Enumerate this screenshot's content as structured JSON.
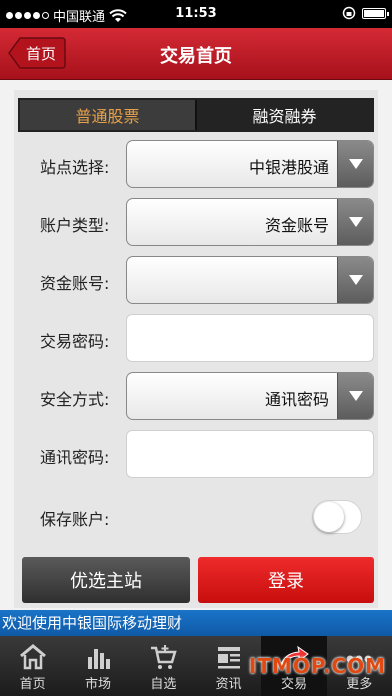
{
  "status": {
    "carrier": "中国联通",
    "time": "11:53"
  },
  "header": {
    "back_label": "首页",
    "title": "交易首页"
  },
  "tabs": [
    {
      "label": "普通股票",
      "active": true
    },
    {
      "label": "融资融券",
      "active": false
    }
  ],
  "form": {
    "site_label": "站点选择:",
    "site_value": "中银港股通",
    "account_type_label": "账户类型:",
    "account_type_value": "资金账号",
    "fund_account_label": "资金账号:",
    "fund_account_value": "",
    "trade_password_label": "交易密码:",
    "security_label": "安全方式:",
    "security_value": "通讯密码",
    "comm_password_label": "通讯密码:",
    "save_account_label": "保存账户:",
    "save_account_on": false
  },
  "buttons": {
    "preferred_site": "优选主站",
    "login": "登录"
  },
  "marquee": "欢迎使用中银国际移动理财",
  "tabbar": [
    {
      "label": "首页",
      "icon": "home-icon"
    },
    {
      "label": "市场",
      "icon": "bar-chart-icon"
    },
    {
      "label": "自选",
      "icon": "cart-icon"
    },
    {
      "label": "资讯",
      "icon": "news-icon"
    },
    {
      "label": "交易",
      "icon": "trade-arrow-icon",
      "active": true
    },
    {
      "label": "更多",
      "icon": "more-icon"
    }
  ],
  "watermark": "ITMOP.COM",
  "colors": {
    "accent_red": "#c70d0d",
    "active_tab_text": "#e8a14a",
    "marquee_blue": "#1a74c8"
  }
}
